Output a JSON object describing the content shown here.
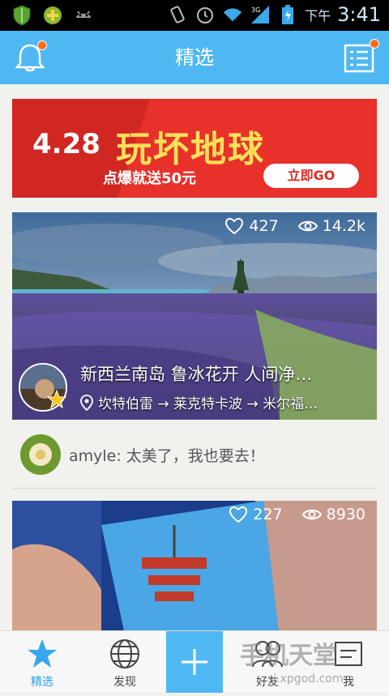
{
  "status_bar": {
    "ampm": "下午",
    "time": "3:41",
    "network_label": "3G"
  },
  "header": {
    "title": "精选"
  },
  "banner": {
    "number": "4.28",
    "title": "玩坏地球",
    "subtitle": "点爆就送50元",
    "cta": "立即GO"
  },
  "feed": [
    {
      "likes": "427",
      "views": "14.2k",
      "title": "新西兰南岛 鲁冰花开 人间净…",
      "route": "坎特伯雷 → 莱克特卡波 → 米尔福…"
    },
    {
      "likes": "227",
      "views": "8930"
    }
  ],
  "comment": {
    "text": "amyle: 太美了，我也要去！"
  },
  "tabbar": {
    "tabs": [
      {
        "label": "精选"
      },
      {
        "label": "发现"
      },
      {
        "label": "好友"
      },
      {
        "label": "我"
      }
    ]
  },
  "watermark": {
    "text": "手机天堂",
    "url": "sj.xpgod.com"
  },
  "colors": {
    "accent": "#4fb8f2",
    "notification": "#ff6a1a",
    "banner_red": "#e8312b",
    "banner_yellow": "#ffe15a"
  }
}
